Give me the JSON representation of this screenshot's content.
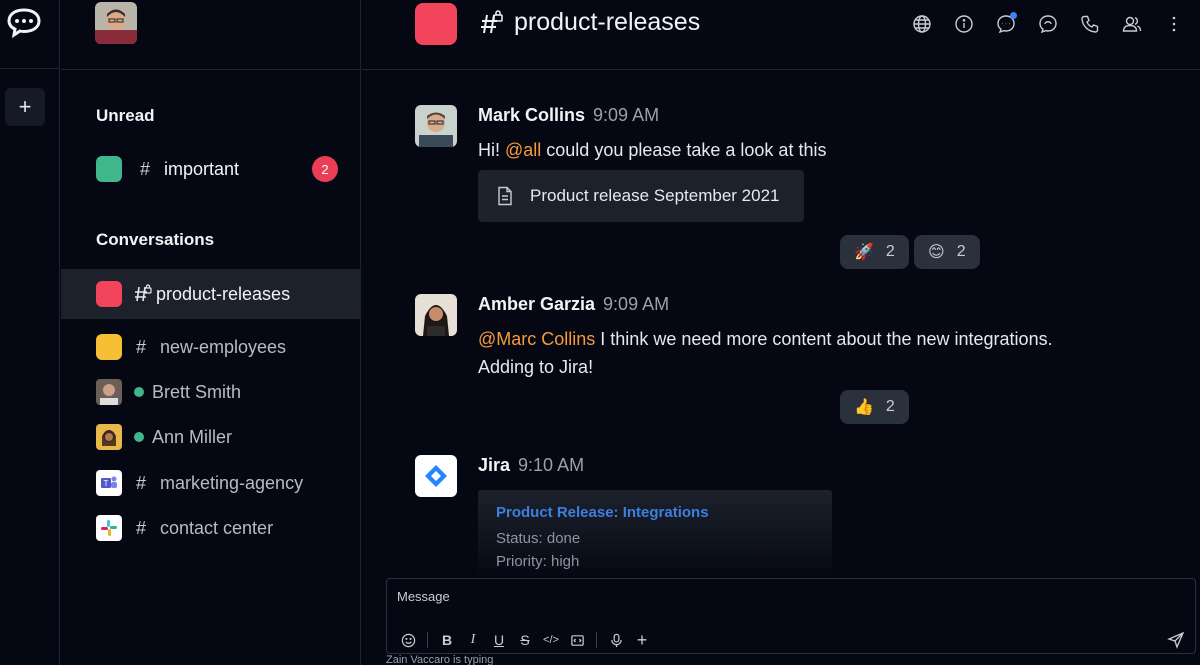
{
  "rail": {
    "add_label": "+"
  },
  "sidebar": {
    "unread_title": "Unread",
    "conversations_title": "Conversations",
    "unread_rooms": [
      {
        "label": "important",
        "prefix": "#",
        "color": "#3fb68b",
        "badge": "2"
      }
    ],
    "rooms": [
      {
        "label": "product-releases",
        "prefix": "#",
        "color": "#f2455c"
      },
      {
        "label": "new-employees",
        "prefix": "#",
        "color": "#f5c033"
      },
      {
        "label": "Brett Smith",
        "status": "online"
      },
      {
        "label": "Ann Miller",
        "status": "online"
      },
      {
        "label": "marketing-agency",
        "prefix": "#"
      },
      {
        "label": "contact center",
        "prefix": "#"
      }
    ]
  },
  "header": {
    "room_name": "product-releases",
    "room_color": "#f2455c",
    "icons": [
      "globe-icon",
      "info-icon",
      "threads-icon",
      "discussion-icon",
      "phone-icon",
      "members-icon",
      "kebab-menu-icon"
    ]
  },
  "messages": [
    {
      "author": "Mark Collins",
      "time": "9:09 AM",
      "text_before": "Hi! ",
      "mention": "@all",
      "text_after": " could you please take a look at this",
      "file": "Product release September 2021",
      "reactions": [
        {
          "emoji": "🚀",
          "count": "2"
        },
        {
          "emoji": "😊",
          "count": "2"
        }
      ]
    },
    {
      "author": "Amber Garzia",
      "time": "9:09 AM",
      "mention": "@Marc Collins",
      "text_after": " I think we need more content about the new integrations.",
      "line2": "Adding to Jira!",
      "reactions": [
        {
          "emoji": "👍",
          "count": "2"
        }
      ]
    },
    {
      "author": "Jira",
      "time": "9:10 AM",
      "attachment": {
        "title": "Product Release: Integrations",
        "status": "Status: done",
        "priority": "Priority: high"
      }
    }
  ],
  "composer": {
    "placeholder": "Message",
    "typing": "Zain Vaccaro is typing"
  },
  "colors": {
    "accent": "#f59b3b",
    "link": "#3e7fe0",
    "online": "#3fb68b",
    "badge": "#ec3d57"
  }
}
